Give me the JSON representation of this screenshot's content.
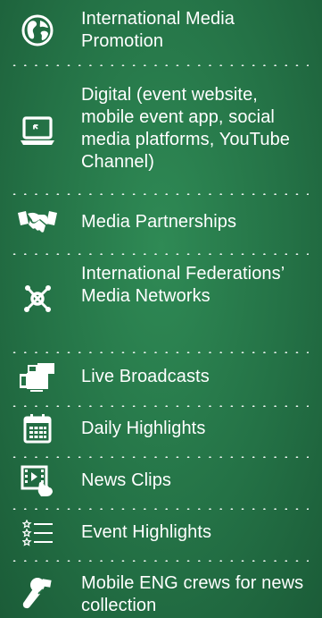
{
  "items": [
    {
      "label": "International Media Promotion",
      "icon": "globe-icon"
    },
    {
      "label": "Digital (event website, mobile event app, social media platforms, YouTube Channel)",
      "icon": "laptop-icon"
    },
    {
      "label": "Media Partnerships",
      "icon": "handshake-icon"
    },
    {
      "label": "International Federations’ Media Networks",
      "icon": "network-icon"
    },
    {
      "label": "Live Broadcasts",
      "icon": "tv-camera-icon"
    },
    {
      "label": "Daily Highlights",
      "icon": "calendar-icon"
    },
    {
      "label": "News Clips",
      "icon": "video-clip-icon"
    },
    {
      "label": "Event Highlights",
      "icon": "star-list-icon"
    },
    {
      "label": "Mobile ENG crews for news collection",
      "icon": "microphone-icon"
    }
  ],
  "colors": {
    "background": "#247246",
    "text": "#ffffff"
  }
}
